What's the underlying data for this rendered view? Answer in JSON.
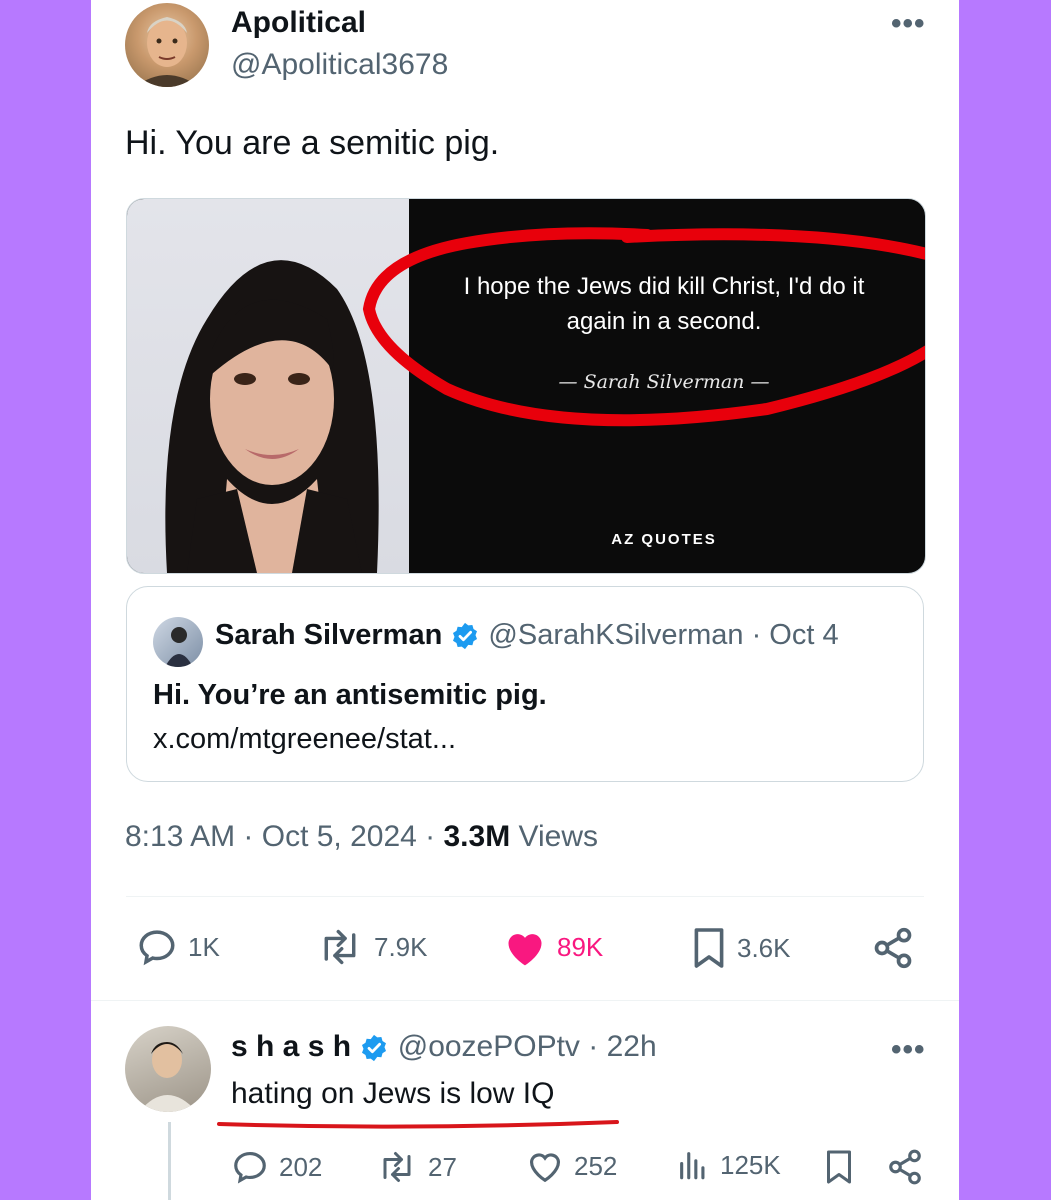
{
  "tweet": {
    "display_name": "Apolitical",
    "handle": "@Apolitical3678",
    "text": "Hi. You are a semitic pig.",
    "image": {
      "quote": "I hope the Jews did kill Christ, I'd do it again in a second.",
      "attribution": "— Sarah Silverman —",
      "brand": "AZ QUOTES",
      "highlight_color": "#e8000b"
    },
    "quoted": {
      "display_name": "Sarah Silverman",
      "handle": "@SarahKSilverman",
      "date": "· Oct 4",
      "text": "Hi. You’re an antisemitic pig.",
      "link": "x.com/mtgreenee/stat..."
    },
    "time": "8:13 AM · Oct 5, 2024 ·",
    "views_count": "3.3M",
    "views_label": "Views",
    "actions": {
      "replies": "1K",
      "reposts": "7.9K",
      "likes": "89K",
      "bookmarks": "3.6K"
    }
  },
  "reply": {
    "display_name": "s h a s h",
    "handle": "@oozePOPtv",
    "time": "· 22h",
    "text": "hating on Jews is low IQ",
    "actions": {
      "replies": "202",
      "reposts": "27",
      "likes": "252",
      "views": "125K"
    }
  },
  "colors": {
    "background": "#b779ff",
    "like_active": "#f91880",
    "verified": "#1d9bf0",
    "underline": "#d8151b"
  }
}
